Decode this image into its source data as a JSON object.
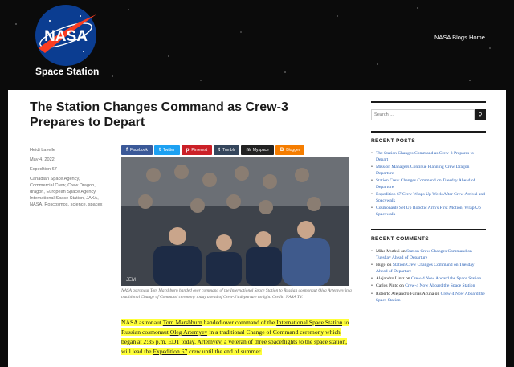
{
  "header": {
    "logo_text": "NASA",
    "site_title": "Space Station",
    "nav_link": "NASA Blogs Home"
  },
  "post": {
    "title": "The Station Changes Command as Crew-3 Prepares to Depart",
    "author": "Heidi Lavelle",
    "date": "May 4, 2022",
    "category": "Expedition 67",
    "tags": "Canadian Space Agency, Commercial Crew, Crew Dragon, dragon, European Space Agency, International Space Station, JAXA, NASA, Roscosmos, science, spacex",
    "share_buttons": [
      {
        "label": "Facebook",
        "glyph": "f",
        "color": "#3b5998"
      },
      {
        "label": "Twitter",
        "glyph": "t",
        "color": "#1da1f2"
      },
      {
        "label": "Pinterest",
        "glyph": "p",
        "color": "#cb2027"
      },
      {
        "label": "Tumblr",
        "glyph": "t",
        "color": "#35465c"
      },
      {
        "label": "Myspace",
        "glyph": "m",
        "color": "#222222"
      },
      {
        "label": "Blogger",
        "glyph": "B",
        "color": "#f57d00"
      }
    ],
    "photo_watermark": "JEM",
    "caption": "NASA astronaut Tom Marshburn handed over command of the International Space Station to Russian cosmonaut Oleg Artemyev in a traditional Change of Command ceremony today ahead of Crew-3's departure tonight. Credit: NASA TV.",
    "paragraph": {
      "t1": "NASA astronaut ",
      "link1": "Tom Marshburn",
      "t2": " handed over command of the ",
      "link2": "International Space Station",
      "t3": " to Russian cosmonaut ",
      "link3": "Oleg Artemyev",
      "t4": " in a traditional Change of Command ceremony which began at 2:35 p.m. EDT today. Artemyev, a veteran of three spaceflights to the space station, will lead the ",
      "link4": "Expedition 67",
      "t5": " crew until the end of summer."
    }
  },
  "sidebar": {
    "search_placeholder": "Search ...",
    "recent_posts_heading": "RECENT POSTS",
    "recent_posts": [
      "The Station Changes Command as Crew-3 Prepares to Depart",
      "Mission Managers Continue Planning Crew Dragon Departure",
      "Station Crew Changes Command on Tuesday Ahead of Departure",
      "Expedition 67 Crew Wraps Up Week After Crew Arrival and Spacewalk",
      "Cosmonauts Set Up Robotic Arm's First Motion, Wrap Up Spacewalk"
    ],
    "recent_comments_heading": "RECENT COMMENTS",
    "recent_comments": [
      {
        "author": "Mike Muthui",
        "on": " on ",
        "post": "Station Crew Changes Command on Tuesday Ahead of Departure"
      },
      {
        "author": "Hugo",
        "on": " on ",
        "post": "Station Crew Changes Command on Tuesday Ahead of Departure"
      },
      {
        "author": "Alejandro Lintz",
        "on": " on ",
        "post": "Crew-4 Now Aboard the Space Station"
      },
      {
        "author": "Carlos Pinto",
        "on": " on ",
        "post": "Crew-4 Now Aboard the Space Station"
      },
      {
        "author": "Roberto Alejandro Farias Acuña",
        "on": " on ",
        "post": "Crew-4 Now Aboard the Space Station"
      }
    ]
  }
}
